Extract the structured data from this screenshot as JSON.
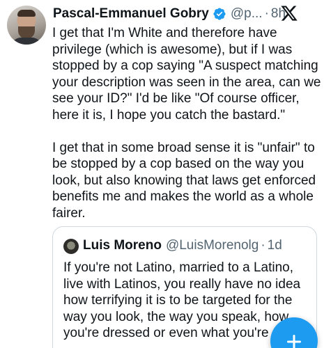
{
  "tweet": {
    "author_name": "Pascal-Emmanuel Gobry",
    "author_handle": "@p...",
    "separator": "·",
    "time": "8h",
    "paragraph_1": "I get that I'm White and therefore have privilege (which is awesome), but if I was stopped by a cop saying \"A suspect matching your description was seen in the area, can we see your ID?\" I'd be like \"Of course officer, here it is, I hope you catch the bastard.\"",
    "paragraph_2": "I get that in some broad sense it is \"unfair\" to be stopped by a cop based on the way you look, but also knowing that laws get enforced benefits me and makes the world as a whole fairer."
  },
  "quoted_tweet": {
    "author_name": "Luis Moreno",
    "author_handle": "@LuisMorenolg",
    "separator": "·",
    "time": "1d",
    "text": "If you're not Latino, married to a Latino, live with Latinos, you really have no idea how terrifying it is to be targeted for the way you look, the way you speak, how you're dressed or even what you're do"
  },
  "icons": {
    "verified": "verified-badge-icon",
    "platform": "x-logo-icon",
    "compose": "plus-icon"
  },
  "colors": {
    "accent": "#1d9bf0",
    "secondary_text": "#536471",
    "border": "#cfd9de"
  }
}
